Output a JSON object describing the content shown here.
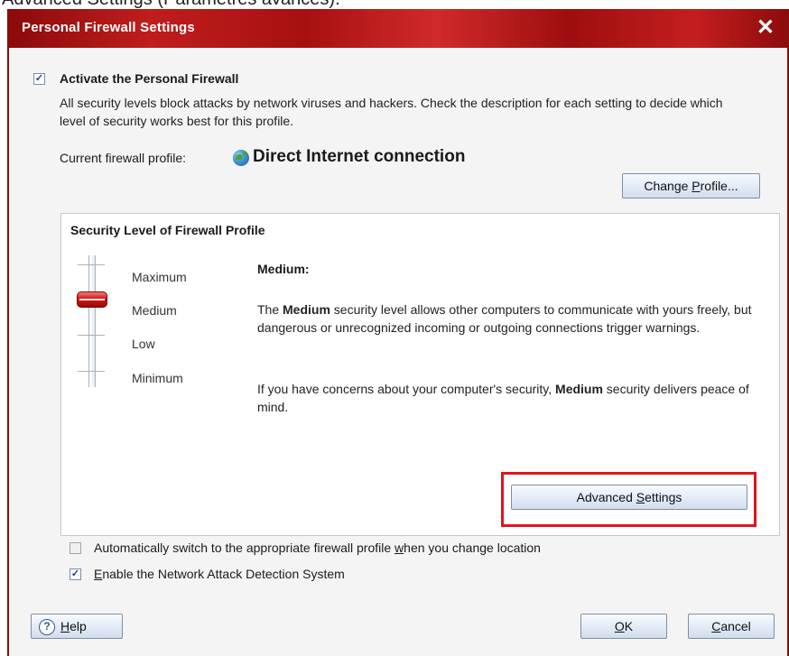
{
  "caption": "Advanced Settings (Paramètres avancés).",
  "window": {
    "title": "Personal Firewall Settings",
    "close_glyph": "✕"
  },
  "activate": {
    "checked": true,
    "label": "Activate the Personal Firewall",
    "description": "All security levels block attacks by network viruses and hackers. Check the description for each setting to decide which level of security works best for this profile."
  },
  "profile": {
    "label": "Current firewall profile:",
    "icon": "globe-icon",
    "name": "Direct Internet connection",
    "change_button": {
      "before": "Change ",
      "mnemonic": "P",
      "after": "rofile..."
    }
  },
  "security": {
    "group_title": "Security Level of Firewall Profile",
    "levels": [
      "Maximum",
      "Medium",
      "Low",
      "Minimum"
    ],
    "selected_level": "Medium",
    "heading": "Medium:",
    "para1_pre": "The ",
    "para1_bold": "Medium",
    "para1_post": " security level allows other computers to communicate with yours freely, but dangerous or unrecognized incoming or outgoing connections trigger warnings.",
    "para2_pre": "If you have concerns about your computer's security, ",
    "para2_bold": "Medium",
    "para2_post": " security delivers peace of mind.",
    "advanced_button": {
      "before": "Advanced ",
      "mnemonic": "S",
      "after": "ettings"
    },
    "highlight_color": "#e0141c"
  },
  "options": {
    "auto_switch": {
      "checked": false,
      "before": "Automatically switch to the appropriate firewall profile ",
      "mnemonic": "w",
      "after": "hen you change location"
    },
    "nads": {
      "checked": true,
      "before": "",
      "mnemonic": "E",
      "after": "nable the Network Attack Detection System"
    }
  },
  "footer": {
    "help": {
      "icon": "help-icon",
      "glyph": "?",
      "mnemonic": "H",
      "after": "elp"
    },
    "ok": {
      "mnemonic": "O",
      "after": "K"
    },
    "cancel": {
      "mnemonic": "C",
      "after": "ancel"
    }
  },
  "colors": {
    "titlebar": "#b01818",
    "accent_red": "#d01717",
    "button_border": "#7d8fa6"
  }
}
